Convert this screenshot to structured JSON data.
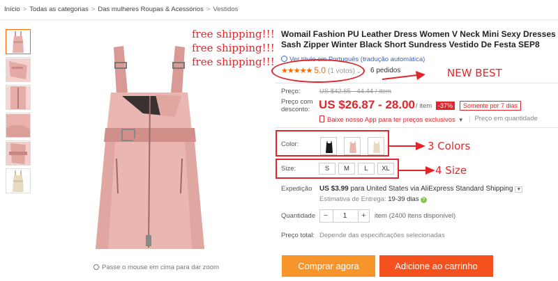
{
  "breadcrumb": [
    "Início",
    "Todas as categorias",
    "Das mulheres Roupas & Acessórios",
    "Vestidos"
  ],
  "gallery": {
    "thumb_count": 6,
    "hover_hint": "Passe o mouse em cima para dar zoom"
  },
  "annotations": {
    "free_shipping": [
      "free shipping!!!",
      "free shipping!!!",
      "free shipping!!!"
    ],
    "new_best": "NEW BEST",
    "colors": "3 Colors",
    "sizes": "4 Size"
  },
  "product": {
    "title": "Womail Fashion PU Leather Dress Women V Neck Mini Sexy Dresses Sash Zipper Winter Black Short Sundress Vestido De Festa SEP8",
    "translate_link": "Ver título em Português (tradução automática)",
    "stars": "★★★★★",
    "rating": "5.0",
    "votes": "(1 votos)",
    "orders": "6 pedidos"
  },
  "pricing": {
    "price_label": "Preço:",
    "old_price": "US $42.65 - 44.44 / item",
    "discount_label_line1": "Preço com",
    "discount_label_line2": "desconto:",
    "price": "US $26.87 - 28.00",
    "per_item": "/ item",
    "discount": "-37%",
    "days_left": "Somente por 7 dias",
    "app_promo": "Baixe nosso App para ter preços exclusivos",
    "qty_price": "Preço em quantidade"
  },
  "options": {
    "color_label": "Color:",
    "colors": [
      {
        "name": "black",
        "hex": "#1a1a1a"
      },
      {
        "name": "pink",
        "hex": "#e8b4b0"
      },
      {
        "name": "beige",
        "hex": "#e8dcc0"
      }
    ],
    "size_label": "Size:",
    "sizes": [
      "S",
      "M",
      "L",
      "XL"
    ]
  },
  "shipping": {
    "label": "Expedição",
    "cost": "US $3.99",
    "to_text": " para ",
    "destination": "United States via AliExpress Standard Shipping",
    "delivery_label": "Estimativa de Entrega:",
    "delivery_days": "19-39 dias",
    "help": "?"
  },
  "quantity": {
    "label": "Quantidade",
    "minus": "−",
    "value": "1",
    "plus": "+",
    "available": "item (2400 itens disponível)"
  },
  "total": {
    "label": "Preço total:",
    "note": "Depende das especificações selecionadas"
  },
  "actions": {
    "buy_now": "Comprar agora",
    "add_to_cart": "Adicione ao carrinho"
  },
  "colors": {
    "accent_red": "#e0262a",
    "orange": "#f7952a",
    "deep_orange": "#f4511e",
    "dress_pink": "#e8b0ac"
  }
}
